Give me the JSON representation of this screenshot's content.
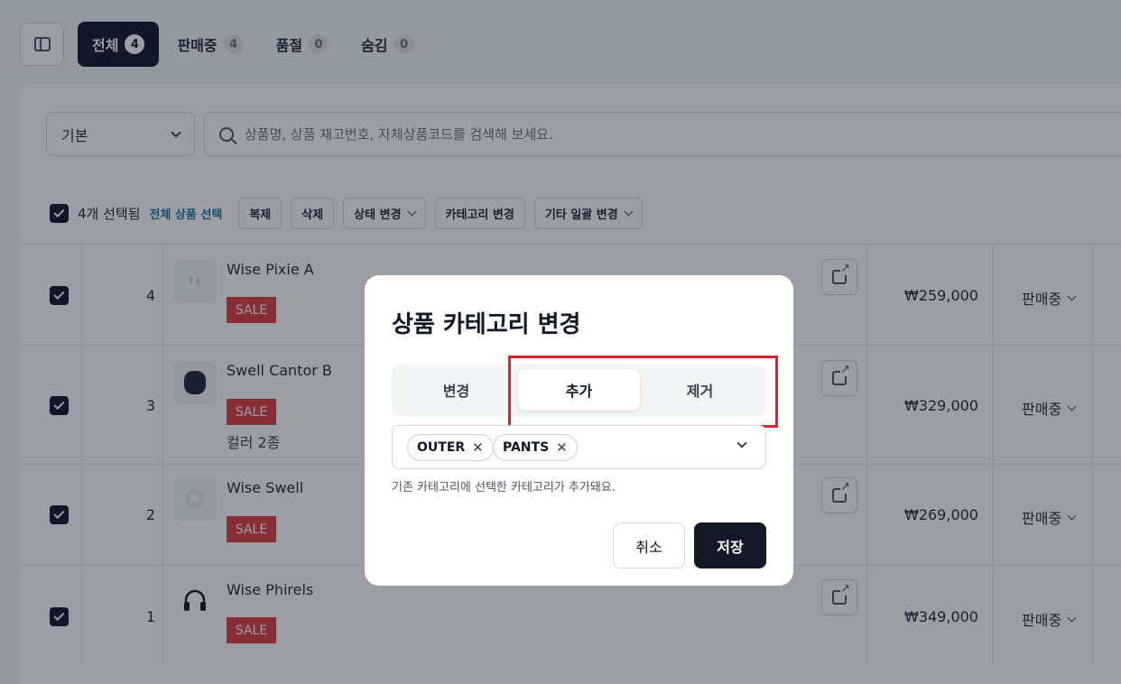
{
  "status_tabs": [
    {
      "label": "전체",
      "count": "4"
    },
    {
      "label": "판매중",
      "count": "4"
    },
    {
      "label": "품절",
      "count": "0"
    },
    {
      "label": "숨김",
      "count": "0"
    }
  ],
  "filter": {
    "value": "기본"
  },
  "search": {
    "placeholder": "상품명, 상품 재고번호, 자체상품코드를 검색해 보세요."
  },
  "bulk": {
    "selected_text": "4개 선택됨",
    "select_all": "전체 상품 선택",
    "actions": [
      "복제",
      "삭제",
      "상태 변경",
      "카테고리 변경",
      "기타 일괄 변경"
    ]
  },
  "products": [
    {
      "index": "4",
      "name": "Wise Pixie A",
      "badge": "SALE",
      "price": "₩259,000",
      "status": "판매중"
    },
    {
      "index": "3",
      "name": "Swell Cantor B",
      "badge": "SALE",
      "variant": "컬러 2종",
      "price": "₩329,000",
      "status": "판매중"
    },
    {
      "index": "2",
      "name": "Wise Swell",
      "badge": "SALE",
      "price": "₩269,000",
      "status": "판매중"
    },
    {
      "index": "1",
      "name": "Wise Phirels",
      "badge": "SALE",
      "price": "₩349,000",
      "status": "판매중"
    }
  ],
  "modal": {
    "title": "상품 카테고리 변경",
    "segments": [
      "변경",
      "추가",
      "제거"
    ],
    "selected_segment": "추가",
    "chips": [
      "OUTER",
      "PANTS"
    ],
    "helper": "기존 카테고리에 선택한 카테고리가 추가돼요.",
    "cancel": "취소",
    "save": "저장"
  },
  "colors": {
    "accent": "#121826",
    "sale": "#dc3e42",
    "highlight": "#d9242f",
    "link": "#1f76a8"
  }
}
